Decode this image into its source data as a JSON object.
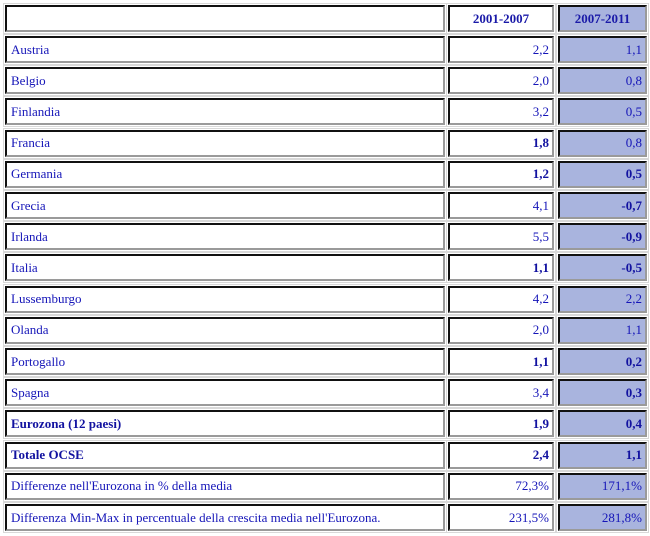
{
  "table": {
    "headers": {
      "label": "",
      "col1": "2001-2007",
      "col2": "2007-2011"
    },
    "rows": [
      {
        "label": "Austria",
        "v1": "2,2",
        "v2": "1,1",
        "label_bold": false,
        "v1_bold": false,
        "v2_bold": false
      },
      {
        "label": "Belgio",
        "v1": "2,0",
        "v2": "0,8",
        "label_bold": false,
        "v1_bold": false,
        "v2_bold": false
      },
      {
        "label": "Finlandia",
        "v1": "3,2",
        "v2": "0,5",
        "label_bold": false,
        "v1_bold": false,
        "v2_bold": false
      },
      {
        "label": "Francia",
        "v1": "1,8",
        "v2": "0,8",
        "label_bold": false,
        "v1_bold": true,
        "v2_bold": false
      },
      {
        "label": "Germania",
        "v1": "1,2",
        "v2": "0,5",
        "label_bold": false,
        "v1_bold": true,
        "v2_bold": true
      },
      {
        "label": "Grecia",
        "v1": "4,1",
        "v2": "-0,7",
        "label_bold": false,
        "v1_bold": false,
        "v2_bold": true
      },
      {
        "label": "Irlanda",
        "v1": "5,5",
        "v2": "-0,9",
        "label_bold": false,
        "v1_bold": false,
        "v2_bold": true
      },
      {
        "label": "Italia",
        "v1": "1,1",
        "v2": "-0,5",
        "label_bold": false,
        "v1_bold": true,
        "v2_bold": true
      },
      {
        "label": "Lussemburgo",
        "v1": "4,2",
        "v2": "2,2",
        "label_bold": false,
        "v1_bold": false,
        "v2_bold": false
      },
      {
        "label": "Olanda",
        "v1": "2,0",
        "v2": "1,1",
        "label_bold": false,
        "v1_bold": false,
        "v2_bold": false
      },
      {
        "label": "Portogallo",
        "v1": "1,1",
        "v2": "0,2",
        "label_bold": false,
        "v1_bold": true,
        "v2_bold": true
      },
      {
        "label": "Spagna",
        "v1": "3,4",
        "v2": "0,3",
        "label_bold": false,
        "v1_bold": false,
        "v2_bold": true
      },
      {
        "label": "Eurozona (12 paesi)",
        "v1": "1,9",
        "v2": "0,4",
        "label_bold": true,
        "v1_bold": true,
        "v2_bold": true
      },
      {
        "label": "Totale OCSE",
        "v1": "2,4",
        "v2": "1,1",
        "label_bold": true,
        "v1_bold": true,
        "v2_bold": true
      },
      {
        "label": "Differenze nell'Eurozona in % della media",
        "v1": "72,3%",
        "v2": "171,1%",
        "label_bold": false,
        "v1_bold": false,
        "v2_bold": false
      },
      {
        "label": "Differenza Min-Max  in percentuale della crescita media nell'Eurozona.",
        "v1": "231,5%",
        "v2": "281,8%",
        "label_bold": false,
        "v1_bold": false,
        "v2_bold": false
      }
    ]
  },
  "colors": {
    "text": "#1515b8",
    "shaded_column": "#a9b4de",
    "border": "#111111"
  }
}
